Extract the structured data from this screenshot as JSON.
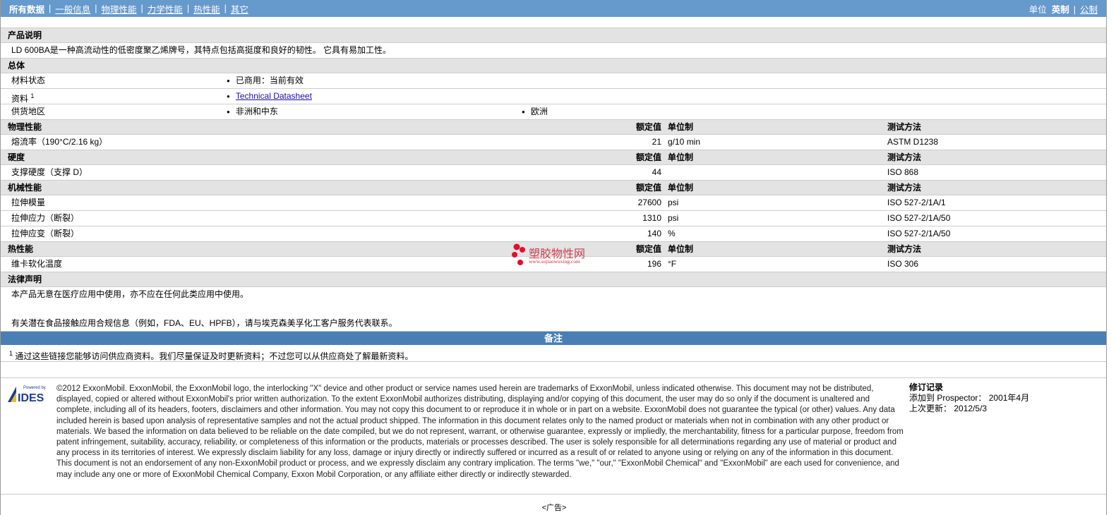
{
  "nav": {
    "items": [
      "所有数据",
      "一般信息",
      "物理性能",
      "力学性能",
      "热性能",
      "其它"
    ],
    "units_label": "单位",
    "unit_active": "英制",
    "unit_other": "公制"
  },
  "desc": {
    "title": "产品说明",
    "text": "LD 600BA是一种高流动性的低密度聚乙烯牌号，其特点包括高挺度和良好的韧性。 它具有易加工性。"
  },
  "general": {
    "title": "总体",
    "rows": [
      {
        "label": "材料状态",
        "values": [
          "已商用：当前有效"
        ]
      },
      {
        "label": "资料",
        "sup": "1",
        "link": "Technical Datasheet"
      },
      {
        "label": "供货地区",
        "values": [
          "非洲和中东",
          "欧洲"
        ]
      }
    ]
  },
  "col_headers": {
    "value": "额定值",
    "unit": "单位制",
    "method": "测试方法"
  },
  "sections": [
    {
      "title": "物理性能",
      "rows": [
        {
          "label": "熔流率（190°C/2.16 kg）",
          "value": "21",
          "unit": "g/10 min",
          "method": "ASTM D1238"
        }
      ]
    },
    {
      "title": "硬度",
      "rows": [
        {
          "label": "支撑硬度（支撑 D）",
          "value": "44",
          "unit": "",
          "method": "ISO 868"
        }
      ]
    },
    {
      "title": "机械性能",
      "rows": [
        {
          "label": "拉伸模量",
          "value": "27600",
          "unit": "psi",
          "method": "ISO 527-2/1A/1"
        },
        {
          "label": "拉伸应力（断裂）",
          "value": "1310",
          "unit": "psi",
          "method": "ISO 527-2/1A/50"
        },
        {
          "label": "拉伸应变（断裂）",
          "value": "140",
          "unit": "%",
          "method": "ISO 527-2/1A/50"
        }
      ]
    },
    {
      "title": "热性能",
      "rows": [
        {
          "label": "维卡软化温度",
          "value": "196",
          "unit": "°F",
          "method": "ISO 306"
        }
      ]
    }
  ],
  "legal": {
    "title": "法律声明",
    "line1": "本产品无意在医疗应用中使用，亦不应在任何此类应用中使用。",
    "line2": "有关潜在食品接触应用合规信息（例如，FDA、EU、HPFB），请与埃克森美孚化工客户服务代表联系。"
  },
  "notes": {
    "title": "备注",
    "sup": "1",
    "text": "通过这些链接您能够访问供应商资料。我们尽量保证及时更新资料；不过您可以从供应商处了解最新资料。"
  },
  "footer": {
    "logo_text": "Powered by IDES",
    "disclaimer": "©2012 ExxonMobil. ExxonMobil, the ExxonMobil logo, the interlocking \"X\" device and other product or service names used herein are trademarks of ExxonMobil, unless indicated otherwise. This document may not be distributed, displayed, copied or altered without ExxonMobil's prior written authorization. To the extent ExxonMobil authorizes distributing, displaying and/or copying of this document, the user may do so only if the document is unaltered and complete, including all of its headers, footers, disclaimers and other information. You may not copy this document to or reproduce it in whole or in part on a website. ExxonMobil does not guarantee the typical (or other) values. Any data included herein is based upon analysis of representative samples and not the actual product shipped. The information in this document relates only to the named product or materials when not in combination with any other product or materials. We based the information on data believed to be reliable on the date compiled, but we do not represent, warrant, or otherwise guarantee, expressly or impliedly, the merchantability, fitness for a particular purpose, freedom from patent infringement, suitability, accuracy, reliability, or completeness of this information or the products, materials or processes described. The user is solely responsible for all determinations regarding any use of material or product and any process in its territories of interest. We expressly disclaim liability for any loss, damage or injury directly or indirectly suffered or incurred as a result of or related to anyone using or relying on any of the information in this document. This document is not an endorsement of any non-ExxonMobil product or process, and we expressly disclaim any contrary implication. The terms \"we,\" \"our,\" \"ExxonMobil Chemical\" and \"ExxonMobil\" are each used for convenience, and may include any one or more of ExxonMobil Chemical Company, Exxon Mobil Corporation, or any affiliate either directly or indirectly stewarded.",
    "revision_title": "修订记录",
    "added_label": "添加到 Prospector：",
    "added_value": "2001年4月",
    "updated_label": "上次更新：",
    "updated_value": "2012/5/3"
  },
  "watermark": {
    "name": "塑胶物性网",
    "url": "www.sujiaowuxing.com"
  },
  "ad": "<广告>"
}
